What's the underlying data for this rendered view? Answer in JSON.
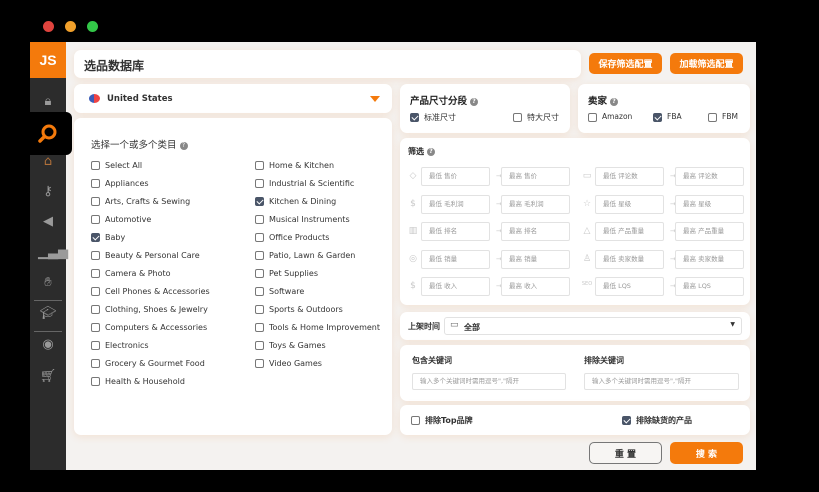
{
  "window": {
    "dots": [
      "#e0443e",
      "#f1a02b",
      "#33c748"
    ]
  },
  "sidebar": {
    "logo": "JS",
    "items": [
      "lock-icon",
      "search-icon",
      "store-icon",
      "key-icon",
      "megaphone-icon",
      "bar-chart-icon",
      "hand-coin-icon",
      "graduation-cap-icon",
      "chrome-icon",
      "cart-icon"
    ],
    "active": "search-icon",
    "accent": "#f47a0c"
  },
  "header": {
    "title": "选品数据库",
    "save_label": "保存筛选配置",
    "load_label": "加载筛选配置"
  },
  "country": {
    "value": "United States",
    "flag": "us-flag-icon"
  },
  "categories": {
    "title": "选择一个或多个类目",
    "items": [
      {
        "label": "Select All",
        "checked": false
      },
      {
        "label": "Appliances",
        "checked": false
      },
      {
        "label": "Arts, Crafts & Sewing",
        "checked": false
      },
      {
        "label": "Automotive",
        "checked": false
      },
      {
        "label": "Baby",
        "checked": true
      },
      {
        "label": "Beauty & Personal Care",
        "checked": false
      },
      {
        "label": "Camera & Photo",
        "checked": false
      },
      {
        "label": "Cell Phones & Accessories",
        "checked": false
      },
      {
        "label": "Clothing, Shoes & Jewelry",
        "checked": false
      },
      {
        "label": "Computers & Accessories",
        "checked": false
      },
      {
        "label": "Electronics",
        "checked": false
      },
      {
        "label": "Grocery & Gourmet Food",
        "checked": false
      },
      {
        "label": "Health & Household",
        "checked": false
      },
      {
        "label": "Home & Kitchen",
        "checked": false
      },
      {
        "label": "Industrial & Scientific",
        "checked": false
      },
      {
        "label": "Kitchen & Dining",
        "checked": true
      },
      {
        "label": "Musical Instruments",
        "checked": false
      },
      {
        "label": "Office Products",
        "checked": false
      },
      {
        "label": "Patio, Lawn & Garden",
        "checked": false
      },
      {
        "label": "Pet Supplies",
        "checked": false
      },
      {
        "label": "Software",
        "checked": false
      },
      {
        "label": "Sports & Outdoors",
        "checked": false
      },
      {
        "label": "Tools & Home Improvement",
        "checked": false
      },
      {
        "label": "Toys & Games",
        "checked": false
      },
      {
        "label": "Video Games",
        "checked": false
      }
    ]
  },
  "size": {
    "title": "产品尺寸分段",
    "options": [
      {
        "label": "标准尺寸",
        "checked": true
      },
      {
        "label": "特大尺寸",
        "checked": false
      }
    ]
  },
  "seller": {
    "title": "卖家",
    "options": [
      {
        "label": "Amazon",
        "checked": false
      },
      {
        "label": "FBA",
        "checked": true
      },
      {
        "label": "FBM",
        "checked": false
      }
    ]
  },
  "filters": {
    "title": "筛选",
    "rows": [
      {
        "icon": "price-tag-icon",
        "min": "最低 售价",
        "max": "最高 售价"
      },
      {
        "icon": "comment-icon",
        "min": "最低 评论数",
        "max": "最高 评论数"
      },
      {
        "icon": "money-bag-icon",
        "min": "最低 毛利润",
        "max": "最高 毛利润"
      },
      {
        "icon": "star-icon",
        "min": "最低 星级",
        "max": "最高 星级"
      },
      {
        "icon": "rank-icon",
        "min": "最低 排名",
        "max": "最高 排名"
      },
      {
        "icon": "weight-icon",
        "min": "最低 产品重量",
        "max": "最高 产品重量"
      },
      {
        "icon": "sales-icon",
        "min": "最低 销量",
        "max": "最高 销量"
      },
      {
        "icon": "sellers-icon",
        "min": "最低 卖家数量",
        "max": "最高 卖家数量"
      },
      {
        "icon": "revenue-icon",
        "min": "最低 收入",
        "max": "最高 收入"
      },
      {
        "icon": "seo-icon",
        "min": "最低 LQS",
        "max": "最高 LQS"
      }
    ]
  },
  "launch": {
    "label": "上架时间",
    "value": "全部"
  },
  "keywords": {
    "include_label": "包含关键词",
    "exclude_label": "排除关键词",
    "placeholder": "输入多个关键词时需用逗号\",\"隔开"
  },
  "exclusions": {
    "top_brand": {
      "label": "排除Top品牌",
      "checked": false
    },
    "out_of_stock": {
      "label": "排除缺货的产品",
      "checked": true
    }
  },
  "actions": {
    "reset": "重 置",
    "search": "搜 索"
  }
}
